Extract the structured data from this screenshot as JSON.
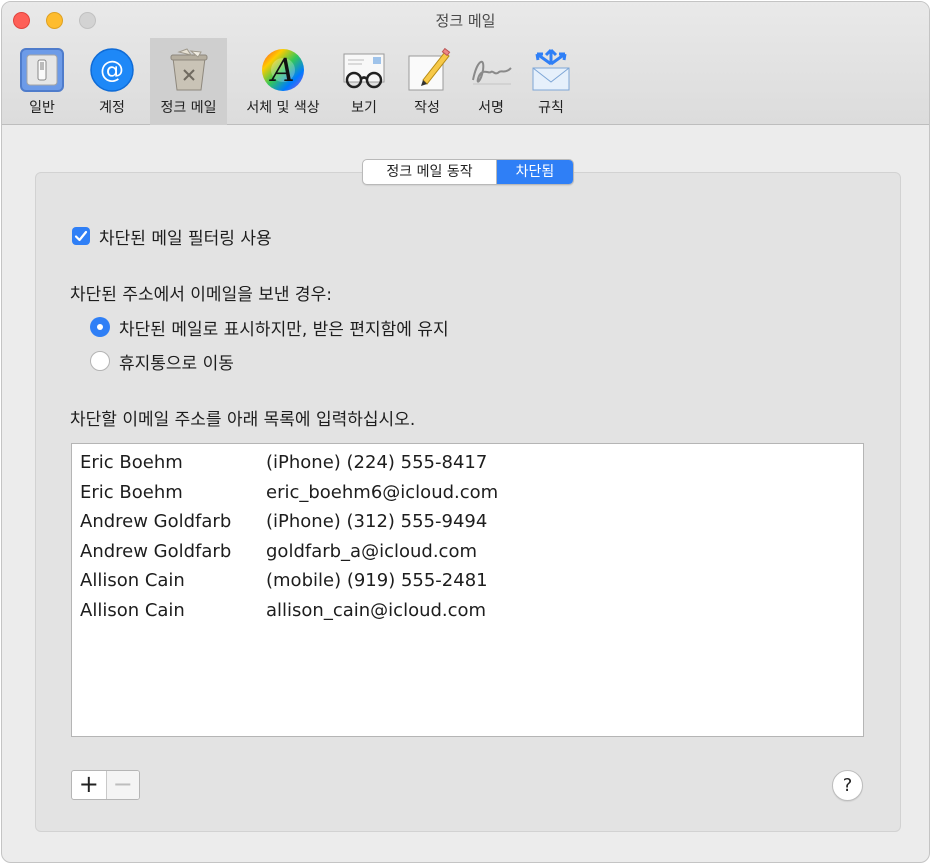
{
  "window": {
    "title": "정크 메일"
  },
  "toolbar": {
    "items": [
      {
        "label": "일반",
        "icon": "general-switch-icon"
      },
      {
        "label": "계정",
        "icon": "at-sign-icon"
      },
      {
        "label": "정크 메일",
        "icon": "junk-trash-icon",
        "selected": true
      },
      {
        "label": "서체 및 색상",
        "icon": "font-color-wheel-icon"
      },
      {
        "label": "보기",
        "icon": "glasses-envelope-icon"
      },
      {
        "label": "작성",
        "icon": "pencil-paper-icon"
      },
      {
        "label": "서명",
        "icon": "signature-icon"
      },
      {
        "label": "규칙",
        "icon": "rules-envelope-icon"
      }
    ]
  },
  "segment": {
    "behavior": "정크 메일 동작",
    "blocked": "차단됨"
  },
  "filtering": {
    "checkbox_label": "차단된 메일 필터링 사용",
    "checked": true
  },
  "when_sent": {
    "label": "차단된 주소에서 이메일을 보낸 경우:",
    "options": [
      {
        "label": "차단된 메일로 표시하지만, 받은 편지함에 유지",
        "selected": true
      },
      {
        "label": "휴지통으로 이동",
        "selected": false
      }
    ]
  },
  "blocked_list": {
    "label": "차단할 이메일 주소를 아래 목록에 입력하십시오.",
    "rows": [
      {
        "name": "Eric Boehm",
        "address": "(iPhone) (224) 555-8417"
      },
      {
        "name": "Eric Boehm",
        "address": "eric_boehm6@icloud.com"
      },
      {
        "name": "Andrew Goldfarb",
        "address": "(iPhone) (312) 555-9494"
      },
      {
        "name": "Andrew Goldfarb",
        "address": "goldfarb_a@icloud.com"
      },
      {
        "name": "Allison Cain",
        "address": "(mobile) (919) 555-2481"
      },
      {
        "name": "Allison Cain",
        "address": "allison_cain@icloud.com"
      }
    ]
  },
  "buttons": {
    "add": "+",
    "remove": "−",
    "help": "?"
  },
  "colors": {
    "accent": "#2f7ff6",
    "close": "#fe5f57",
    "minimize": "#febc2e"
  }
}
